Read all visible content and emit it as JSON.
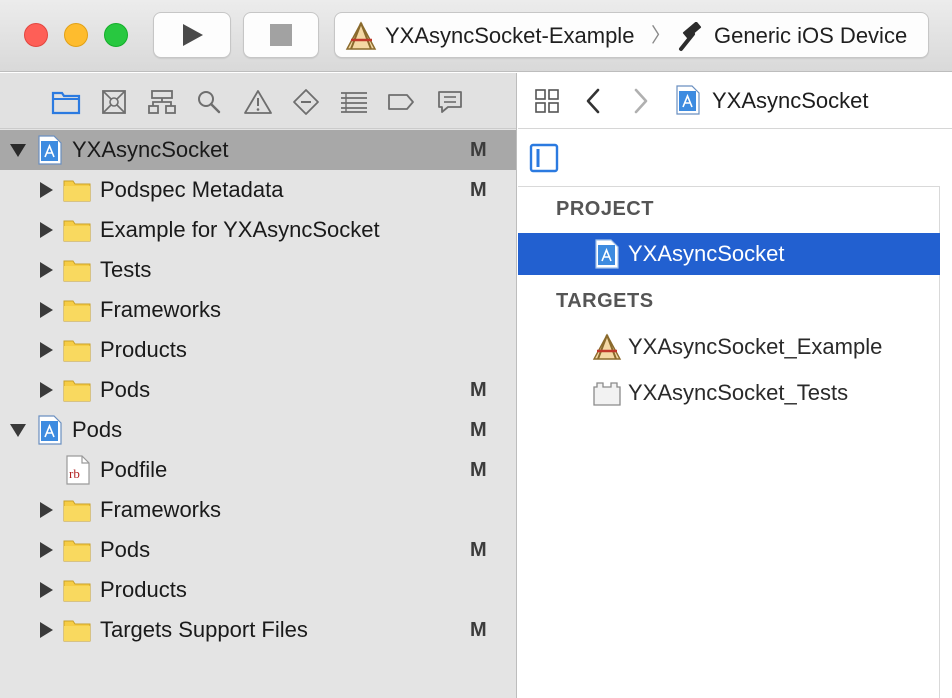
{
  "toolbar": {
    "scheme": "YXAsyncSocket-Example",
    "separator": "〉",
    "device": "Generic iOS Device"
  },
  "navigator": {
    "tabs": [
      "project-navigator",
      "source-control",
      "symbols",
      "find",
      "issues",
      "tests",
      "debug",
      "breakpoints",
      "reports"
    ],
    "rows": [
      {
        "label": "YXAsyncSocket",
        "badge": "M"
      },
      {
        "label": "Podspec Metadata",
        "badge": "M"
      },
      {
        "label": "Example for YXAsyncSocket",
        "badge": ""
      },
      {
        "label": "Tests",
        "badge": ""
      },
      {
        "label": "Frameworks",
        "badge": ""
      },
      {
        "label": "Products",
        "badge": ""
      },
      {
        "label": "Pods",
        "badge": "M"
      },
      {
        "label": "Pods",
        "badge": "M"
      },
      {
        "label": "Podfile",
        "badge": "M"
      },
      {
        "label": "Frameworks",
        "badge": ""
      },
      {
        "label": "Pods",
        "badge": "M"
      },
      {
        "label": "Products",
        "badge": ""
      },
      {
        "label": "Targets Support Files",
        "badge": "M"
      }
    ],
    "podfile_icon_text": "rb"
  },
  "editor": {
    "jumpbar_title": "YXAsyncSocket",
    "project_header": "PROJECT",
    "project_item": "YXAsyncSocket",
    "targets_header": "TARGETS",
    "targets": [
      "YXAsyncSocket_Example",
      "YXAsyncSocket_Tests"
    ]
  },
  "colors": {
    "selection_blue": "#2260d0",
    "navigator_selection": "#a8a8a8",
    "active_tab_blue": "#2b7ae0",
    "folder_yellow": "#f6cd45"
  }
}
